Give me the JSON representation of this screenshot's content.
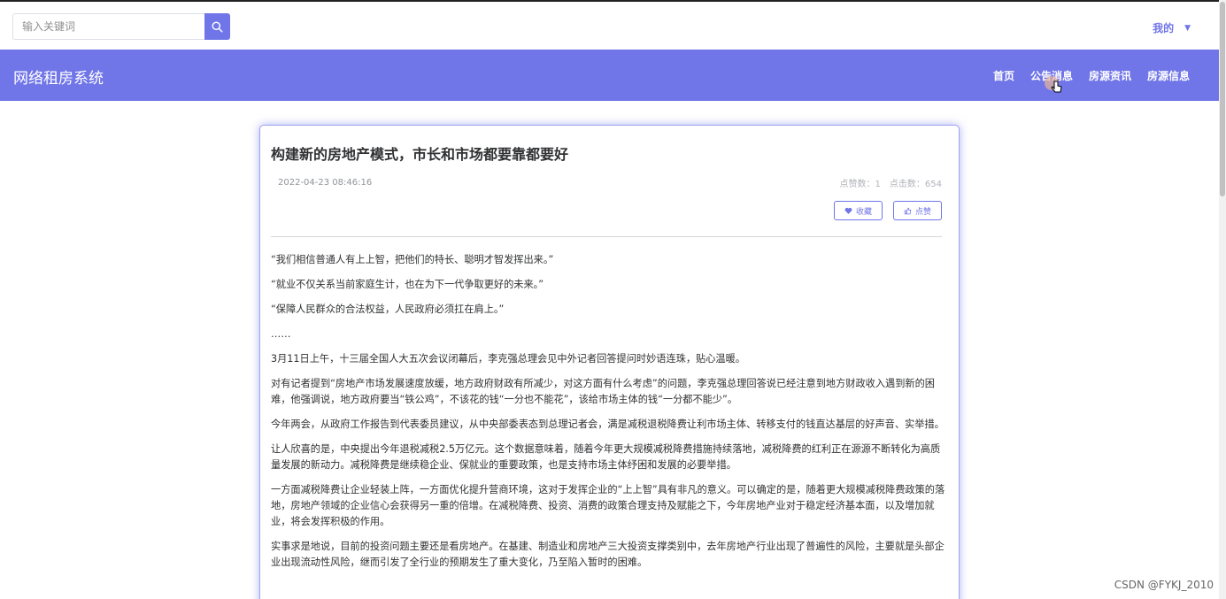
{
  "search": {
    "placeholder": "输入关键词"
  },
  "header": {
    "user_menu": "我的"
  },
  "navbar": {
    "brand": "网络租房系统",
    "links": [
      "首页",
      "公告消息",
      "房源资讯",
      "房源信息"
    ]
  },
  "article": {
    "title": "构建新的房地产模式，市长和市场都要靠都要好",
    "date": "2022-04-23 08:46:16",
    "likes_label": "点赞数：1",
    "views_label": "点击数：654",
    "favorite_label": "收藏",
    "like_label": "点赞",
    "paragraphs": [
      "“我们相信普通人有上上智，把他们的特长、聪明才智发挥出来。”",
      "“就业不仅关系当前家庭生计，也在为下一代争取更好的未来。”",
      "“保障人民群众的合法权益，人民政府必须扛在肩上。”",
      "……",
      "3月11日上午，十三届全国人大五次会议闭幕后，李克强总理会见中外记者回答提问时妙语连珠，贴心温暖。",
      "对有记者提到“房地产市场发展速度放缓，地方政府财政有所减少，对这方面有什么考虑”的问题，李克强总理回答说已经注意到地方财政收入遇到新的困难，他强调说，地方政府要当“铁公鸡”，不该花的钱“一分也不能花”，该给市场主体的钱“一分都不能少”。",
      "今年两会，从政府工作报告到代表委员建议，从中央部委表态到总理记者会，满是减税退税降费让利市场主体、转移支付的钱直达基层的好声音、实举措。",
      "让人欣喜的是，中央提出今年退税减税2.5万亿元。这个数据意味着，随着今年更大规模减税降费措施持续落地，减税降费的红利正在源源不断转化为高质量发展的新动力。减税降费是继续稳企业、保就业的重要政策，也是支持市场主体纾困和发展的必要举措。",
      "一方面减税降费让企业轻装上阵，一方面优化提升营商环境，这对于发挥企业的“上上智”具有非凡的意义。可以确定的是，随着更大规模减税降费政策的落地，房地产领域的企业信心会获得另一重的倍增。在减税降费、投资、消费的政策合理支持及赋能之下，今年房地产业对于稳定经济基本面，以及增加就业，将会发挥积极的作用。",
      "实事求是地说，目前的投资问题主要还是看房地产。在基建、制造业和房地产三大投资支撑类别中，去年房地产行业出现了普遍性的风险，主要就是头部企业出现流动性风险，继而引发了全行业的预期发生了重大变化，乃至陷入暂时的困难。"
    ]
  },
  "watermark": "CSDN @FYKJ_2010",
  "colors": {
    "accent": "#7075e8",
    "text": "#303133",
    "muted": "#909399"
  }
}
